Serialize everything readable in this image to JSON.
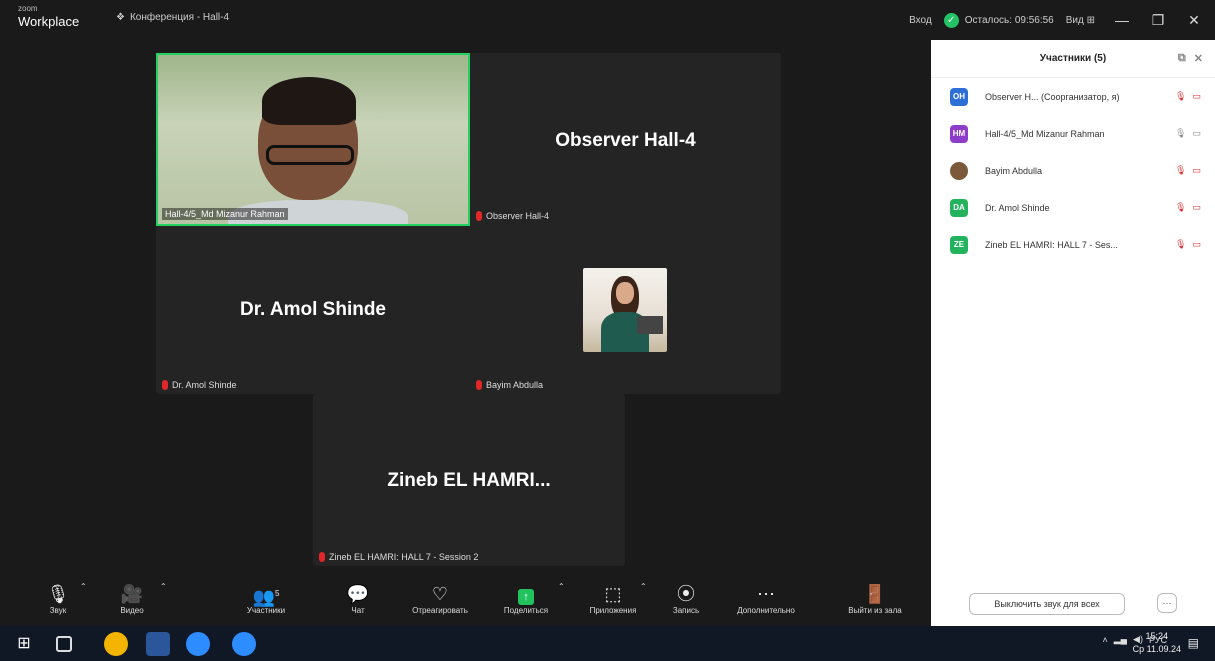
{
  "window": {
    "brand_small": "zoom",
    "brand_big": "Workplace",
    "title": "Конференция - Hall-4",
    "login": "Вход",
    "remaining": "Осталось: 09:56:56",
    "view": "Вид ⊞",
    "minimize": "—",
    "maximize": "❐",
    "close": "✕"
  },
  "stage": {
    "video_label": "Hall-4/5_Md Mizanur Rahman",
    "observer_name": "Observer  Hall-4",
    "observer_label": "Observer  Hall-4",
    "amol_name": "Dr. Amol Shinde",
    "amol_label": "Dr. Amol Shinde",
    "bayim_label": "Bayim Abdulla",
    "zineb_name": "Zineb EL HAMRI...",
    "zineb_label": "Zineb EL HAMRI:   HALL 7  - Session 2"
  },
  "toolbar": {
    "audio": "Звук",
    "video": "Видео",
    "participants": "Участники",
    "participants_count": "5",
    "chat": "Чат",
    "react": "Отреагировать",
    "share": "Поделиться",
    "apps": "Приложения",
    "record": "Запись",
    "more": "Дополнительно",
    "leave": "Выйти из зала"
  },
  "panel": {
    "title": "Участники (5)",
    "participants": [
      {
        "initials": "OH",
        "name": "Observer  H... (Соорганизатор, я)",
        "color": "#2d6fd6"
      },
      {
        "initials": "HM",
        "name": "Hall-4/5_Md Mizanur Rahman",
        "color": "#8e3dc9"
      },
      {
        "initials": "",
        "name": "Bayim Abdulla",
        "color": "#7a5a3a"
      },
      {
        "initials": "DA",
        "name": "Dr. Amol Shinde",
        "color": "#23b35e"
      },
      {
        "initials": "ZE",
        "name": "Zineb EL HAMRI:  HALL 7 - Ses...",
        "color": "#23b35e"
      }
    ],
    "mute_all": "Выключить звук для всех",
    "more": "···"
  },
  "taskbar": {
    "lang": "РУС",
    "time": "15:24",
    "date": "Ср 11.09.24"
  }
}
